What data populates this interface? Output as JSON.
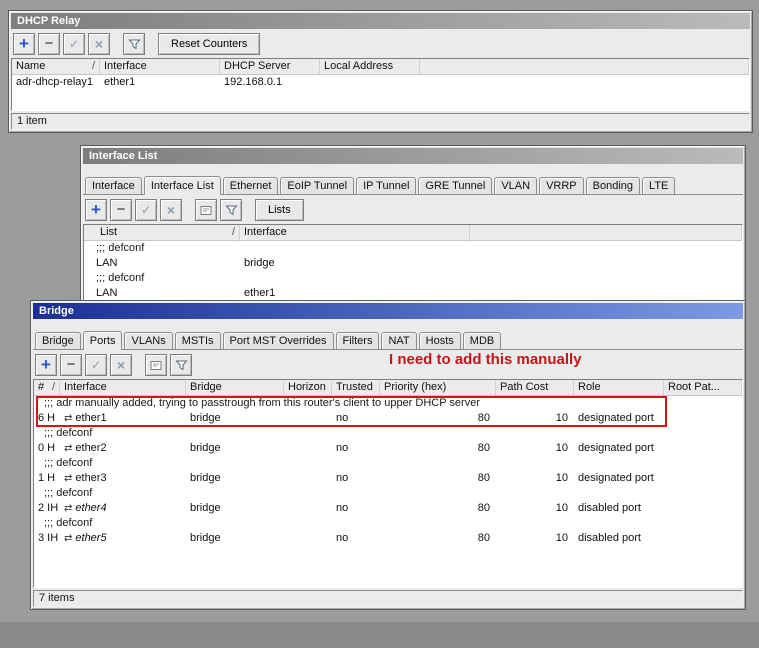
{
  "colors": {
    "desktop_bg": "#9c9c9c",
    "desktop_band": "#8a8a8a",
    "active_title_blue_start": "#1a2f96",
    "active_title_blue_end": "#7b9ae2",
    "inactive_title_gray": "#7d7d7d",
    "annotation_red": "#c41616",
    "highlight_box_red": "#dd1111",
    "toolbar_plus_blue": "#2a57c6"
  },
  "icons": {
    "add": "+",
    "remove": "−",
    "enable": "✓",
    "disable": "×",
    "interface_port": "⇄",
    "sort": "/"
  },
  "windows": {
    "dhcp_relay": {
      "title": "DHCP Relay",
      "toolbar": {
        "reset_counters": "Reset Counters"
      },
      "table": {
        "columns": [
          "Name",
          "Interface",
          "DHCP Server",
          "Local Address"
        ],
        "rows": [
          {
            "name": "adr-dhcp-relay1",
            "interface": "ether1",
            "dhcp_server": "192.168.0.1",
            "local_address": ""
          }
        ]
      },
      "status": "1 item"
    },
    "interface_list": {
      "title": "Interface List",
      "tabs": [
        "Interface",
        "Interface List",
        "Ethernet",
        "EoIP Tunnel",
        "IP Tunnel",
        "GRE Tunnel",
        "VLAN",
        "VRRP",
        "Bonding",
        "LTE"
      ],
      "selected_tab": "Interface List",
      "toolbar": {
        "lists": "Lists"
      },
      "table": {
        "columns": [
          "List",
          "Interface"
        ],
        "rows": [
          {
            "type": "comment",
            "text": ";;; defconf"
          },
          {
            "type": "item",
            "list": "LAN",
            "interface": "bridge"
          },
          {
            "type": "comment",
            "text": ";;; defconf"
          },
          {
            "type": "item",
            "list": "LAN",
            "interface": "ether1"
          }
        ]
      }
    },
    "bridge": {
      "title": "Bridge",
      "tabs": [
        "Bridge",
        "Ports",
        "VLANs",
        "MSTIs",
        "Port MST Overrides",
        "Filters",
        "NAT",
        "Hosts",
        "MDB"
      ],
      "selected_tab": "Ports",
      "annotation": "I need to add this manually",
      "table": {
        "columns": [
          "#",
          "Interface",
          "Bridge",
          "Horizon",
          "Trusted",
          "Priority (hex)",
          "Path Cost",
          "Role",
          "Root Pat..."
        ],
        "rows": [
          {
            "type": "comment",
            "text": ";;; adr manually added, trying to passtrough from this router's client to upper DHCP server"
          },
          {
            "type": "item",
            "num": "6 H",
            "interface": "ether1",
            "bridge": "bridge",
            "horizon": "",
            "trusted": "no",
            "priority": "80",
            "path_cost": "10",
            "role": "designated port"
          },
          {
            "type": "comment",
            "text": ";;; defconf"
          },
          {
            "type": "item",
            "num": "0 H",
            "interface": "ether2",
            "bridge": "bridge",
            "horizon": "",
            "trusted": "no",
            "priority": "80",
            "path_cost": "10",
            "role": "designated port"
          },
          {
            "type": "comment",
            "text": ";;; defconf"
          },
          {
            "type": "item",
            "num": "1 H",
            "interface": "ether3",
            "bridge": "bridge",
            "horizon": "",
            "trusted": "no",
            "priority": "80",
            "path_cost": "10",
            "role": "designated port"
          },
          {
            "type": "comment",
            "text": ";;; defconf"
          },
          {
            "type": "item",
            "num": "2 IH",
            "interface": "ether4",
            "bridge": "bridge",
            "horizon": "",
            "trusted": "no",
            "priority": "80",
            "path_cost": "10",
            "role": "disabled port",
            "inactive": true
          },
          {
            "type": "comment",
            "text": ";;; defconf"
          },
          {
            "type": "item",
            "num": "3 IH",
            "interface": "ether5",
            "bridge": "bridge",
            "horizon": "",
            "trusted": "no",
            "priority": "80",
            "path_cost": "10",
            "role": "disabled port",
            "inactive": true
          }
        ]
      },
      "status": "7 items"
    }
  }
}
